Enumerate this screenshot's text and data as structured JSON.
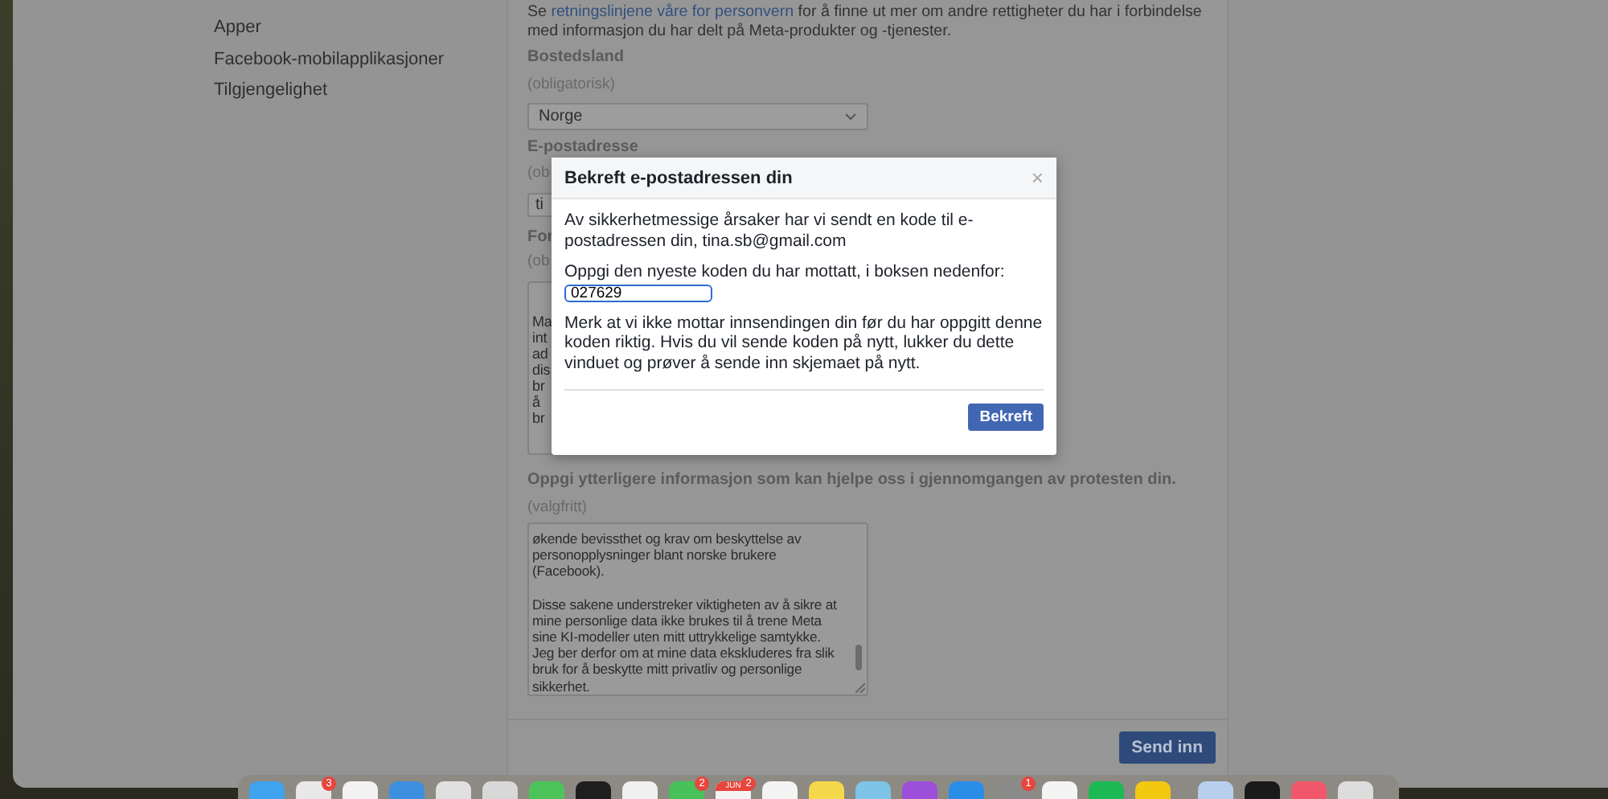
{
  "sidebar": {
    "items": [
      "Apper",
      "Facebook-mobilapplikasjoner",
      "Tilgjengelighet"
    ]
  },
  "form": {
    "intro": {
      "before": "Se ",
      "link": "retningslinjene våre for personvern",
      "after": " for å finne ut mer om andre rettigheter du har i forbindelse med informasjon du har delt på Meta-produkter og -tjenester."
    },
    "country": {
      "label": "Bostedsland",
      "hint": "(obligatorisk)",
      "value": "Norge"
    },
    "email": {
      "label": "E-postadresse",
      "hint": "(ob",
      "value": "ti"
    },
    "reason": {
      "label": "For",
      "hint": "(ob",
      "lines": [
        "Ma",
        "int",
        "ad",
        "dis",
        "br",
        "å",
        "br"
      ]
    },
    "extra": {
      "label": "Oppgi ytterligere informasjon som kan hjelpe oss i gjennomgangen av protesten din.",
      "hint": "(valgfritt)",
      "paragraphs": [
        [
          "økende bevissthet og krav om beskyttelse av",
          "personopplysninger blant norske brukere",
          "(Facebook)."
        ],
        [
          "Disse sakene understreker viktigheten av å sikre at",
          "mine personlige data ikke brukes til å trene Meta",
          "sine KI-modeller uten mitt uttrykkelige samtykke.",
          "Jeg ber derfor om at mine data ekskluderes fra slik",
          "bruk for å beskytte mitt privatliv og personlige",
          "sikkerhet."
        ]
      ]
    },
    "submit": "Send inn"
  },
  "dialog": {
    "title": "Bekreft e-postadressen din",
    "close": "×",
    "message": "Av sikkerhetmessige årsaker har vi sendt en kode til e-postadressen din, tina.sb@gmail.com",
    "prompt": "Oppgi den nyeste koden du har mottatt, i boksen nedenfor:",
    "code": "027629",
    "note": "Merk at vi ikke mottar innsendingen din før du har oppgitt denne koden riktig. Hvis du vil sende koden på nytt, lukker du dette vinduet og prøver å sende inn skjemaet på nytt.",
    "confirm": "Bekreft"
  },
  "dock": {
    "items": [
      {
        "color": "#3fa3f0"
      },
      {
        "color": "#e8e8e8",
        "badge": "3"
      },
      {
        "color": "#f2f2f2"
      },
      {
        "color": "#3d8fe0"
      },
      {
        "color": "#e0e0e0"
      },
      {
        "color": "#d8d8d8"
      },
      {
        "color": "#4cc45a"
      },
      {
        "color": "#1e1e1e"
      },
      {
        "color": "#f0f0f0"
      },
      {
        "color": "#47c159",
        "badge": "2"
      },
      {
        "color": "#f4f4f4",
        "label": "JUN",
        "badge": "2"
      },
      {
        "color": "#f4f4f4"
      },
      {
        "color": "#f5d84a"
      },
      {
        "color": "#7dc4e8"
      },
      {
        "color": "#9c4fd8"
      },
      {
        "color": "#2a8de8"
      },
      {
        "color": "#8a8a8a",
        "badge": "1"
      },
      {
        "color": "#f4f4f4"
      },
      {
        "color": "#1db954"
      },
      {
        "color": "#f2c811"
      },
      {
        "color": "#b8d0ee",
        "sep": true
      },
      {
        "color": "#1a1a1a"
      },
      {
        "color": "#f2566a"
      },
      {
        "color": "#dcdcdc"
      }
    ]
  }
}
